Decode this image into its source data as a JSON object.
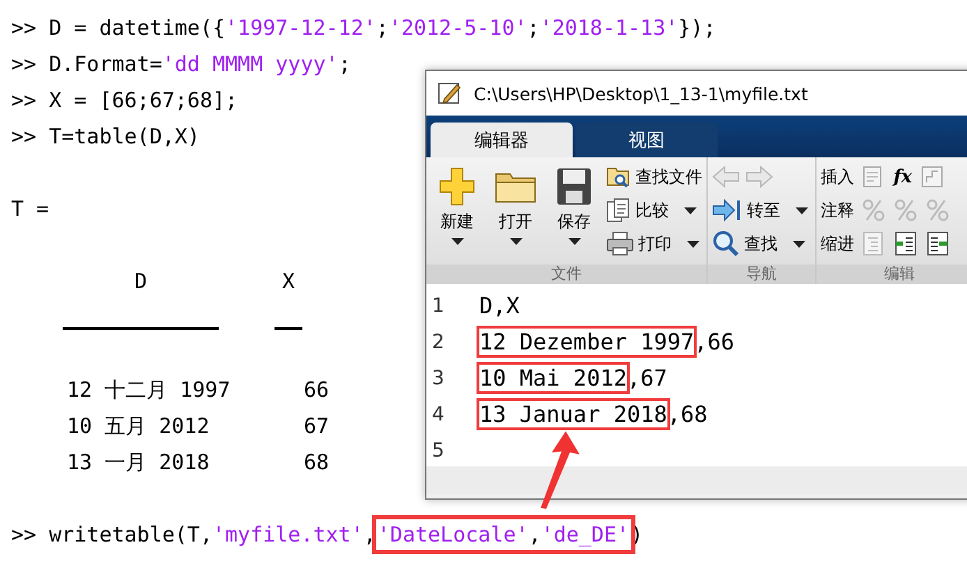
{
  "command_window": {
    "blocks": [
      {
        "kind": "command",
        "segments": [
          {
            "kind": "code",
            "text": ">> D = datetime({"
          },
          {
            "kind": "string",
            "text": "'1997-12-12'"
          },
          {
            "kind": "code",
            "text": ";"
          },
          {
            "kind": "string",
            "text": "'2012-5-10'"
          },
          {
            "kind": "code",
            "text": ";"
          },
          {
            "kind": "string",
            "text": "'2018-1-13'"
          },
          {
            "kind": "code",
            "text": "});"
          }
        ]
      },
      {
        "kind": "command",
        "segments": [
          {
            "kind": "code",
            "text": ">> D.Format="
          },
          {
            "kind": "string",
            "text": "'dd MMMM yyyy'"
          },
          {
            "kind": "code",
            "text": ";"
          }
        ]
      },
      {
        "kind": "command",
        "segments": [
          {
            "kind": "code",
            "text": ">> X = [66;67;68];"
          }
        ]
      },
      {
        "kind": "command",
        "segments": [
          {
            "kind": "code",
            "text": ">> T=table(D,X)"
          }
        ]
      },
      {
        "kind": "blank"
      },
      {
        "kind": "output",
        "text": "T ="
      },
      {
        "kind": "blank"
      },
      {
        "kind": "table",
        "columns": [
          "D",
          "X"
        ],
        "rows": [
          [
            "12 十二月 1997",
            "66"
          ],
          [
            "10 五月 2012",
            "67"
          ],
          [
            "13 一月 2018",
            "68"
          ]
        ]
      },
      {
        "kind": "command",
        "segments": [
          {
            "kind": "code",
            "text": ">> writetable(T,"
          },
          {
            "kind": "string",
            "text": "'myfile.txt'"
          },
          {
            "kind": "code",
            "text": ","
          },
          {
            "kind": "group",
            "boxed": true,
            "segments": [
              {
                "kind": "string",
                "text": "'DateLocale'"
              },
              {
                "kind": "code",
                "text": ","
              },
              {
                "kind": "string",
                "text": "'de_DE'"
              }
            ]
          },
          {
            "kind": "code",
            "text": ")"
          }
        ]
      }
    ]
  },
  "editor": {
    "title": "C:\\Users\\HP\\Desktop\\1_13-1\\myfile.txt",
    "tabs": [
      {
        "label": "编辑器",
        "selected": true
      },
      {
        "label": "视图",
        "selected": false
      }
    ],
    "groups": [
      {
        "label": "文件",
        "large": [
          {
            "label": "新建",
            "dropdown": true
          },
          {
            "label": "打开",
            "dropdown": true
          },
          {
            "label": "保存",
            "dropdown": true
          }
        ],
        "small": [
          {
            "kind": "button",
            "label": "查找文件",
            "dropdown": false
          },
          {
            "kind": "button",
            "label": "比较",
            "dropdown": true
          },
          {
            "kind": "button",
            "label": "打印",
            "dropdown": true
          }
        ]
      },
      {
        "label": "导航",
        "small": [
          {
            "kind": "arrows",
            "disabled": true
          },
          {
            "kind": "button",
            "label": "转至",
            "dropdown": true
          },
          {
            "kind": "button",
            "label": "查找",
            "dropdown": true
          }
        ]
      },
      {
        "label": "编辑",
        "small": [
          {
            "kind": "row",
            "label": "插入",
            "symbol": "fx"
          },
          {
            "kind": "row",
            "label": "注释"
          },
          {
            "kind": "row",
            "label": "缩进"
          }
        ]
      }
    ],
    "lines": [
      {
        "number": "1",
        "segments": [
          {
            "text": "D,X",
            "boxed": false
          }
        ]
      },
      {
        "number": "2",
        "segments": [
          {
            "text": "12 Dezember 1997",
            "boxed": true
          },
          {
            "text": ",66",
            "boxed": false
          }
        ]
      },
      {
        "number": "3",
        "segments": [
          {
            "text": "10 Mai 2012",
            "boxed": true
          },
          {
            "text": ",67",
            "boxed": false
          }
        ]
      },
      {
        "number": "4",
        "segments": [
          {
            "text": "13 Januar 2018",
            "boxed": true
          },
          {
            "text": ",68",
            "boxed": false
          }
        ]
      },
      {
        "number": "5"
      }
    ]
  }
}
